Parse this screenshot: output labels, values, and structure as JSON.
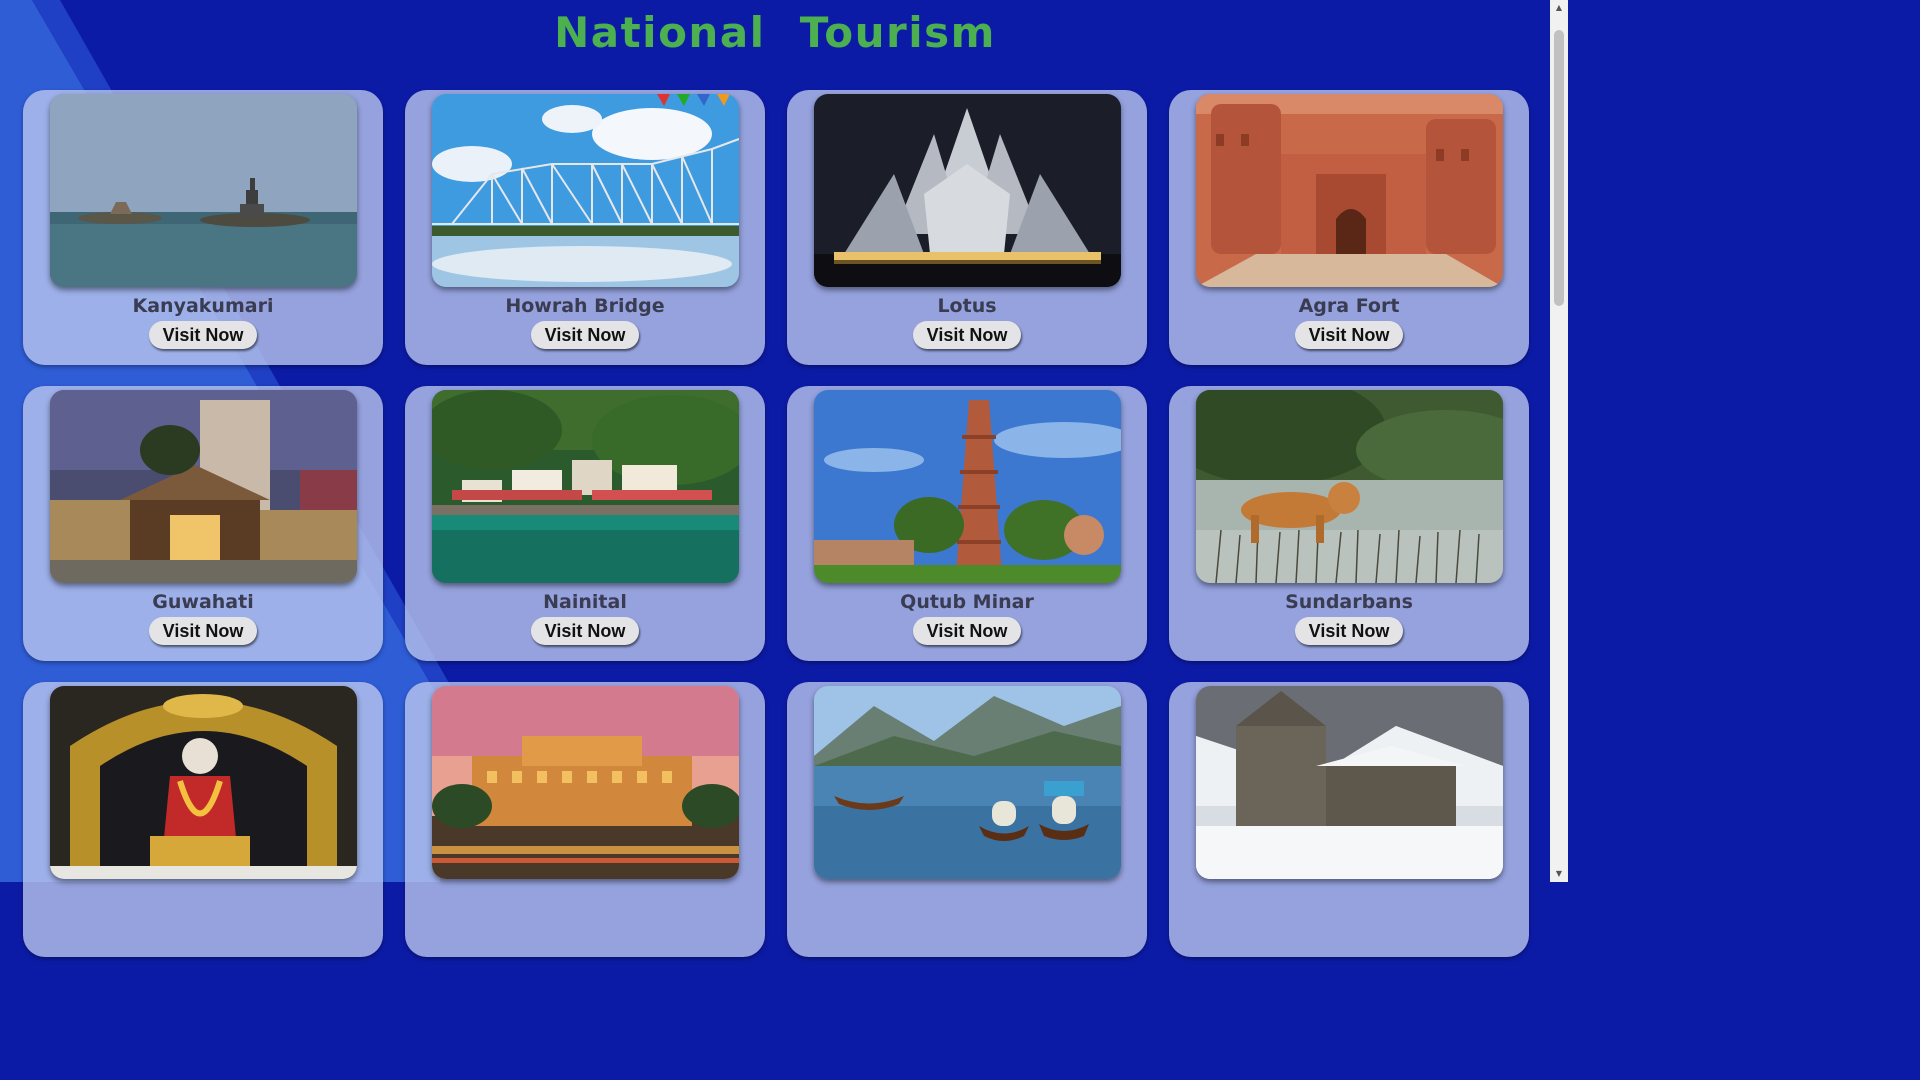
{
  "header": {
    "title": "National  Tourism",
    "title_color": "#4caf50"
  },
  "background": {
    "base_color": "#0c1ba6",
    "light_band_color": "#2f5dd6"
  },
  "cards": [
    {
      "name": "Kanyakumari",
      "button": "Visit Now",
      "image": "kanyakumari-photo"
    },
    {
      "name": "Howrah Bridge",
      "button": "Visit Now",
      "image": "howrah-bridge-photo"
    },
    {
      "name": "Lotus",
      "button": "Visit Now",
      "image": "lotus-temple-photo"
    },
    {
      "name": "Agra Fort",
      "button": "Visit Now",
      "image": "agra-fort-photo"
    },
    {
      "name": "Guwahati",
      "button": "Visit Now",
      "image": "guwahati-photo"
    },
    {
      "name": "Nainital",
      "button": "Visit Now",
      "image": "nainital-photo"
    },
    {
      "name": "Qutub Minar",
      "button": "Visit Now",
      "image": "qutub-minar-photo"
    },
    {
      "name": "Sundarbans",
      "button": "Visit Now",
      "image": "sundarbans-photo"
    },
    {
      "name": "",
      "button": "",
      "image": "shirdi-sai-baba-photo"
    },
    {
      "name": "",
      "button": "",
      "image": "hawa-mahal-photo"
    },
    {
      "name": "",
      "button": "",
      "image": "dal-lake-photo"
    },
    {
      "name": "",
      "button": "",
      "image": "kedarnath-photo"
    }
  ]
}
